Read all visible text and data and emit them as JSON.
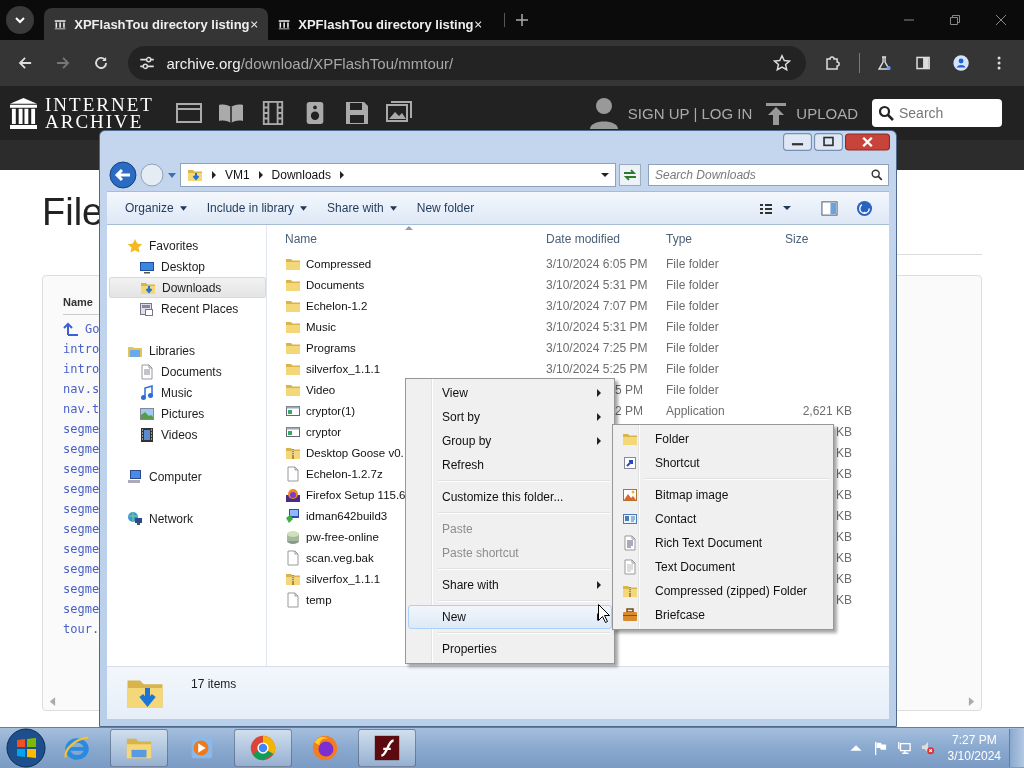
{
  "browser": {
    "tabs": [
      {
        "title": "XPFlashTou directory listing",
        "selected": true
      },
      {
        "title": "XPFlashTou directory listing",
        "selected": false
      }
    ],
    "url": {
      "host": "archive.org",
      "path": "/download/XPFlashTou/mmtour/"
    }
  },
  "site_header": {
    "logo": [
      "INTERNET",
      "ARCHIVE"
    ],
    "account": "SIGN UP | LOG IN",
    "upload": "UPLOAD",
    "search": {
      "placeholder": "Search"
    }
  },
  "page": {
    "heading": "File",
    "column": "Name",
    "parent_link": "Go",
    "links": [
      "intro",
      "intro",
      "nav.s",
      "nav.t",
      "segme",
      "segme",
      "segme",
      "segme",
      "segme",
      "segme",
      "segme",
      "segme",
      "segme",
      "segme",
      "tour."
    ]
  },
  "explorer": {
    "path": [
      "VM1",
      "Downloads"
    ],
    "search": {
      "placeholder": "Search Downloads"
    },
    "commands": [
      {
        "label": "Organize",
        "menu": true
      },
      {
        "label": "Include in library",
        "menu": true
      },
      {
        "label": "Share with",
        "menu": true
      },
      {
        "label": "New folder",
        "menu": false
      }
    ],
    "nav": [
      {
        "label": "Favorites",
        "children": [
          {
            "label": "Desktop",
            "selected": false
          },
          {
            "label": "Downloads",
            "selected": true
          },
          {
            "label": "Recent Places",
            "selected": false
          }
        ]
      },
      {
        "label": "Libraries",
        "children": [
          {
            "label": "Documents",
            "selected": false
          },
          {
            "label": "Music",
            "selected": false
          },
          {
            "label": "Pictures",
            "selected": false
          },
          {
            "label": "Videos",
            "selected": false
          }
        ]
      },
      {
        "label": "Computer"
      },
      {
        "label": "Network"
      }
    ],
    "columns": [
      "Name",
      "Date modified",
      "Type",
      "Size"
    ],
    "rows": [
      {
        "name": "Compressed",
        "kind": "folder",
        "date": "3/10/2024 6:05 PM",
        "type": "File folder"
      },
      {
        "name": "Documents",
        "kind": "folder",
        "date": "3/10/2024 5:31 PM",
        "type": "File folder"
      },
      {
        "name": "Echelon-1.2",
        "kind": "folder",
        "date": "3/10/2024 7:07 PM",
        "type": "File folder"
      },
      {
        "name": "Music",
        "kind": "folder",
        "date": "3/10/2024 5:31 PM",
        "type": "File folder"
      },
      {
        "name": "Programs",
        "kind": "folder",
        "date": "3/10/2024 7:25 PM",
        "type": "File folder"
      },
      {
        "name": "silverfox_1.1.1",
        "kind": "folder",
        "date": "3/10/2024 5:25 PM",
        "type": "File folder"
      },
      {
        "name": "Video",
        "kind": "folder",
        "date": "5 PM",
        "type": "File folder"
      },
      {
        "name": "cryptor(1)",
        "kind": "application",
        "date": "2 PM",
        "type": "Application",
        "size": "2,621 KB"
      },
      {
        "name": "cryptor",
        "kind": "application",
        "size": "KB"
      },
      {
        "name": "Desktop Goose v0.",
        "kind": "zip",
        "size": "KB"
      },
      {
        "name": "Echelon-1.2.7z",
        "kind": "file",
        "size": "KB"
      },
      {
        "name": "Firefox Setup 115.6",
        "kind": "setup",
        "size": "KB"
      },
      {
        "name": "idman642build3",
        "kind": "installer",
        "size": "KB"
      },
      {
        "name": "pw-free-online",
        "kind": "disc",
        "size": "KB"
      },
      {
        "name": "scan.veg.bak",
        "kind": "file",
        "size": "KB"
      },
      {
        "name": "silverfox_1.1.1",
        "kind": "zip",
        "size": "KB"
      },
      {
        "name": "temp",
        "kind": "file",
        "size": "KB"
      }
    ],
    "status": "17 items"
  },
  "context_menu": {
    "groups": [
      [
        {
          "label": "View",
          "submenu": true,
          "disabled": false,
          "selected": false
        },
        {
          "label": "Sort by",
          "submenu": true,
          "disabled": false,
          "selected": false
        },
        {
          "label": "Group by",
          "submenu": true,
          "disabled": false,
          "selected": false
        },
        {
          "label": "Refresh",
          "submenu": false,
          "disabled": false,
          "selected": false
        }
      ],
      [
        {
          "label": "Customize this folder...",
          "submenu": false,
          "disabled": false,
          "selected": false
        }
      ],
      [
        {
          "label": "Paste",
          "submenu": false,
          "disabled": true,
          "selected": false
        },
        {
          "label": "Paste shortcut",
          "submenu": false,
          "disabled": true,
          "selected": false
        }
      ],
      [
        {
          "label": "Share with",
          "submenu": true,
          "disabled": false,
          "selected": false
        }
      ],
      [
        {
          "label": "New",
          "submenu": true,
          "disabled": false,
          "selected": true
        }
      ],
      [
        {
          "label": "Properties",
          "submenu": false,
          "disabled": false,
          "selected": false
        }
      ]
    ]
  },
  "submenu": {
    "groups": [
      [
        "Folder",
        "Shortcut"
      ],
      [
        "Bitmap image",
        "Contact",
        "Rich Text Document",
        "Text Document",
        "Compressed (zipped) Folder",
        "Briefcase"
      ]
    ]
  },
  "taskbar": {
    "apps": [
      {
        "open": false
      },
      {
        "open": true
      },
      {
        "open": false
      },
      {
        "open": true
      },
      {
        "open": false
      },
      {
        "open": true
      }
    ],
    "time": "7:27 PM",
    "date": "3/10/2024"
  }
}
